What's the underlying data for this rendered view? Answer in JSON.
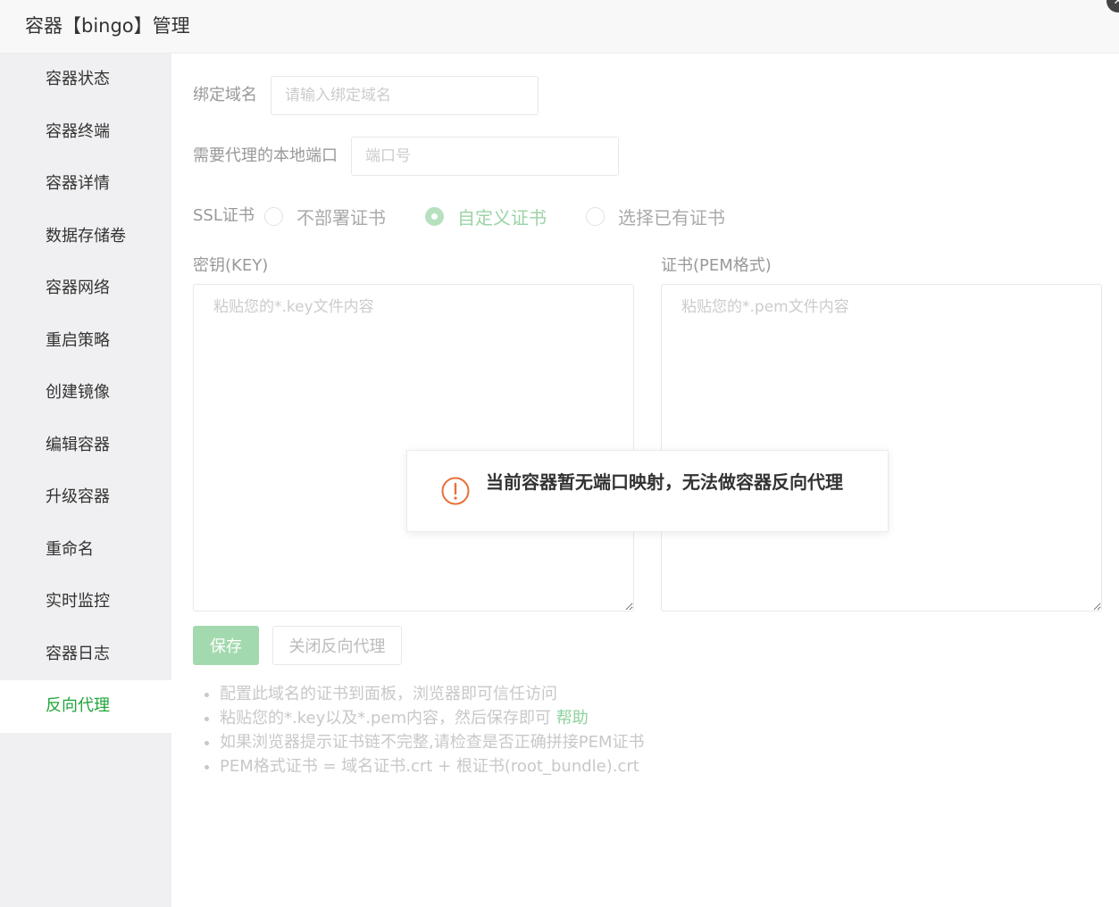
{
  "window": {
    "title": "容器【bingo】管理",
    "close_glyph": "✕"
  },
  "sidebar": {
    "items": [
      {
        "label": "容器状态"
      },
      {
        "label": "容器终端"
      },
      {
        "label": "容器详情"
      },
      {
        "label": "数据存储卷"
      },
      {
        "label": "容器网络"
      },
      {
        "label": "重启策略"
      },
      {
        "label": "创建镜像"
      },
      {
        "label": "编辑容器"
      },
      {
        "label": "升级容器"
      },
      {
        "label": "重命名"
      },
      {
        "label": "实时监控"
      },
      {
        "label": "容器日志"
      },
      {
        "label": "反向代理",
        "active": true
      }
    ]
  },
  "form": {
    "domain": {
      "label": "绑定域名",
      "placeholder": "请输入绑定域名",
      "value": ""
    },
    "port": {
      "label": "需要代理的本地端口",
      "placeholder": "端口号",
      "value": ""
    },
    "ssl": {
      "label": "SSL证书",
      "options": [
        {
          "label": "不部署证书",
          "checked": false
        },
        {
          "label": "自定义证书",
          "checked": true
        },
        {
          "label": "选择已有证书",
          "checked": false
        }
      ]
    },
    "key": {
      "label": "密钥(KEY)",
      "placeholder": "粘贴您的*.key文件内容"
    },
    "cert": {
      "label": "证书(PEM格式)",
      "placeholder": "粘贴您的*.pem文件内容"
    },
    "save_label": "保存",
    "close_proxy_label": "关闭反向代理"
  },
  "tips": {
    "line1": "配置此域名的证书到面板，浏览器即可信任访问",
    "line2": "粘贴您的*.key以及*.pem内容，然后保存即可",
    "help_link": "帮助",
    "line3": "如果浏览器提示证书链不完整,请检查是否正确拼接PEM证书",
    "line4": "PEM格式证书 = 域名证书.crt + 根证书(root_bundle).crt"
  },
  "toast": {
    "message": "当前容器暂无端口映射，无法做容器反向代理",
    "icon": "warning-circle-icon",
    "color": "#e8703a"
  },
  "colors": {
    "accent": "#20a53a"
  }
}
